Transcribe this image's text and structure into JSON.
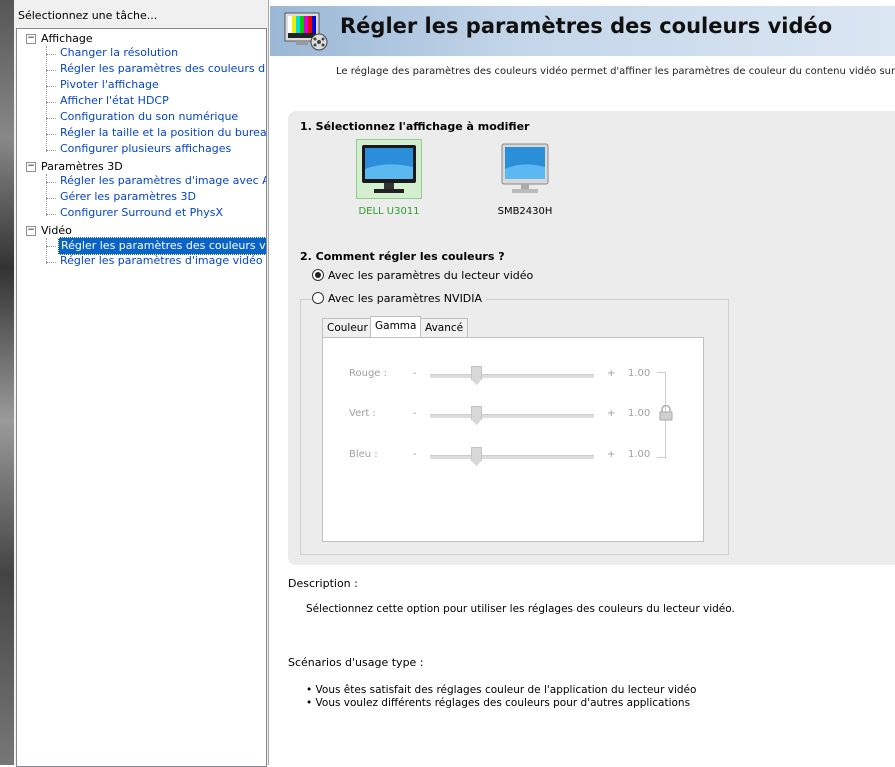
{
  "left_pane": {
    "header": "Sélectionnez une tâche...",
    "groups": [
      {
        "label": "Affichage",
        "items": [
          "Changer la résolution",
          "Régler les paramètres des couleurs du bure",
          "Pivoter l'affichage",
          "Afficher l'état HDCP",
          "Configuration du son numérique",
          "Régler la taille et la position du bureau",
          "Configurer plusieurs affichages"
        ]
      },
      {
        "label": "Paramètres 3D",
        "items": [
          "Régler les paramètres d'image avec Aperçu",
          "Gérer les paramètres 3D",
          "Configurer Surround et PhysX"
        ]
      },
      {
        "label": "Vidéo",
        "items": [
          "Régler les paramètres des couleurs vidéo",
          "Régler les paramètres d'image vidéo"
        ]
      }
    ],
    "selected_item": "Régler les paramètres des couleurs vidéo",
    "expander_symbol": "−"
  },
  "page": {
    "title": "Régler les paramètres des couleurs vidéo",
    "intro": "Le réglage des paramètres des couleurs vidéo permet d'affiner les paramètres de couleur du contenu vidéo sur l'affichag"
  },
  "section1": {
    "heading": "1. Sélectionnez l'affichage à modifier",
    "displays": [
      {
        "name": "DELL U3011",
        "selected": true
      },
      {
        "name": "SMB2430H",
        "selected": false
      }
    ]
  },
  "section2": {
    "heading": "2. Comment régler les couleurs ?",
    "options": [
      {
        "label": "Avec les paramètres du lecteur vidéo",
        "checked": true
      },
      {
        "label": "Avec les paramètres NVIDIA",
        "checked": false
      }
    ],
    "tabs": [
      "Couleur",
      "Gamma",
      "Avancé"
    ],
    "active_tab": "Gamma",
    "sliders": [
      {
        "label": "Rouge :",
        "minus": "-",
        "plus": "+",
        "value": "1.00"
      },
      {
        "label": "Vert :",
        "minus": "-",
        "plus": "+",
        "value": "1.00"
      },
      {
        "label": "Bleu :",
        "minus": "-",
        "plus": "+",
        "value": "1.00"
      }
    ]
  },
  "description": {
    "heading": "Description :",
    "text": "Sélectionnez cette option pour utiliser les réglages des couleurs du lecteur vidéo."
  },
  "usage": {
    "heading": "Scénarios d'usage type :",
    "bullets": [
      "• Vous êtes satisfait des réglages couleur de l'application du lecteur vidéo",
      "• Vous voulez différents réglages des couleurs pour d'autres applications"
    ]
  },
  "colors": {
    "selected_bg": "#0a64c8",
    "link": "#0645c8",
    "dell_label": "#2ba02b",
    "title_bar": "#9ab7d6"
  }
}
